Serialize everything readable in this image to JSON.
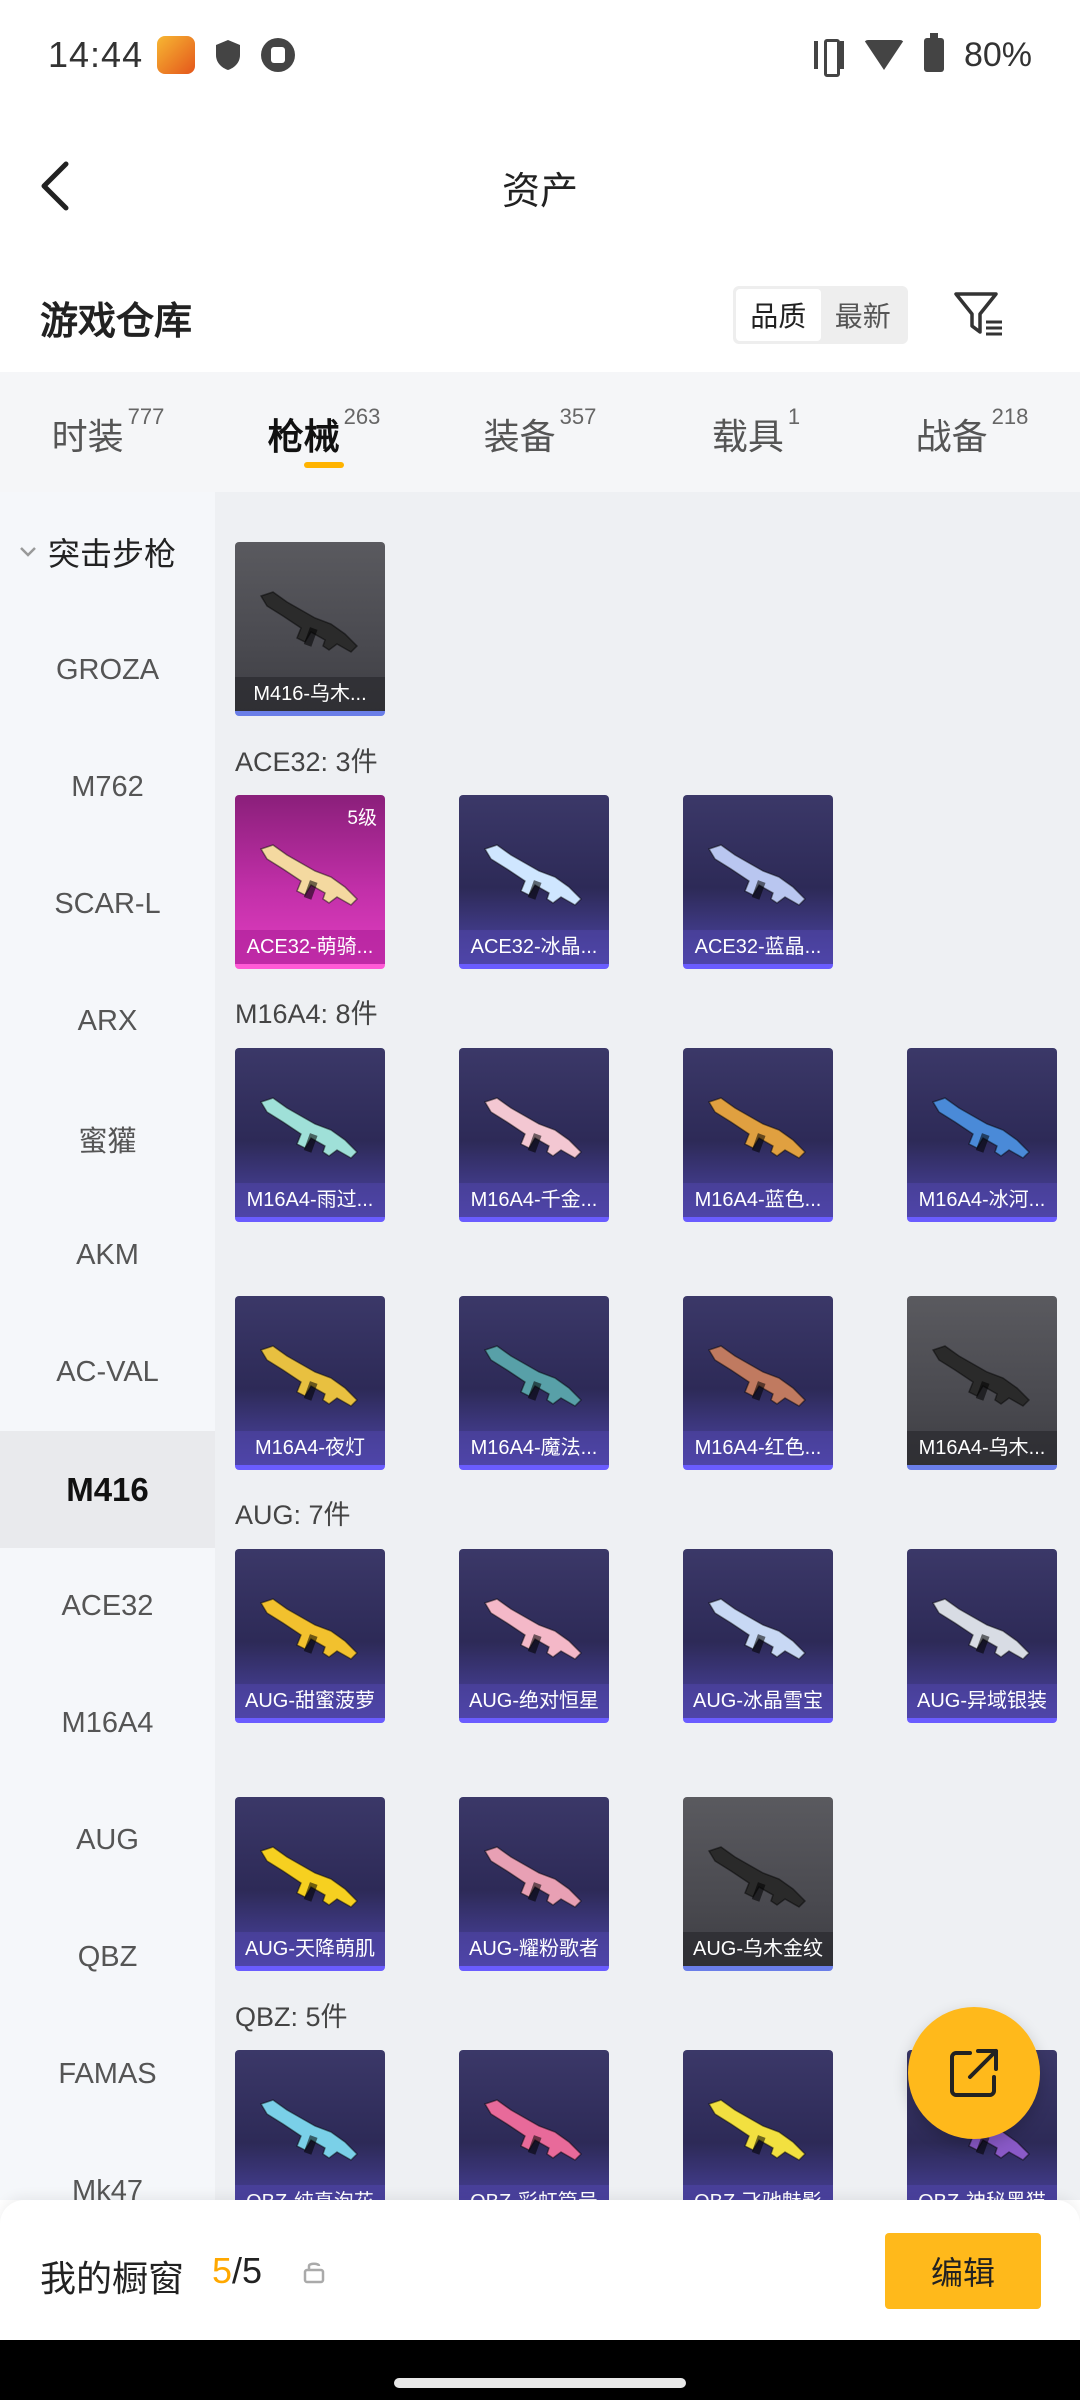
{
  "status_bar": {
    "time": "14:44",
    "battery": "80%"
  },
  "header": {
    "title": "资产"
  },
  "section": {
    "title": "游戏仓库",
    "sort_options": [
      "品质",
      "最新"
    ]
  },
  "tabs": [
    {
      "label": "时装",
      "count": "777"
    },
    {
      "label": "枪械",
      "count": "263"
    },
    {
      "label": "装备",
      "count": "357"
    },
    {
      "label": "载具",
      "count": "1"
    },
    {
      "label": "战备",
      "count": "218"
    }
  ],
  "sidebar": {
    "category": "突击步枪",
    "items": [
      "GROZA",
      "M762",
      "SCAR-L",
      "ARX",
      "蜜獾",
      "AKM",
      "AC-VAL",
      "M416",
      "ACE32",
      "M16A4",
      "AUG",
      "QBZ",
      "FAMAS",
      "Mk47"
    ]
  },
  "groups": {
    "m416": {
      "items": [
        {
          "name": "M416-乌木...",
          "rarity": "gray",
          "gun_color": "#2b2b2b"
        }
      ]
    },
    "ace32": {
      "label": "ACE32: 3件",
      "items": [
        {
          "name": "ACE32-萌骑...",
          "rarity": "pink",
          "badge": "5级",
          "gun_color": "#f4d9a0"
        },
        {
          "name": "ACE32-冰晶...",
          "rarity": "purple",
          "gun_color": "#cfe6ff"
        },
        {
          "name": "ACE32-蓝晶...",
          "rarity": "purple",
          "gun_color": "#b9c6f0"
        }
      ]
    },
    "m16a4": {
      "label": "M16A4: 8件",
      "items": [
        {
          "name": "M16A4-雨过...",
          "rarity": "purple",
          "gun_color": "#9fe0d8"
        },
        {
          "name": "M16A4-千金...",
          "rarity": "purple",
          "gun_color": "#f3c7d2"
        },
        {
          "name": "M16A4-蓝色...",
          "rarity": "purple",
          "gun_color": "#e0a040"
        },
        {
          "name": "M16A4-冰河...",
          "rarity": "purple",
          "gun_color": "#4a8ad8"
        },
        {
          "name": "M16A4-夜灯",
          "rarity": "purple",
          "gun_color": "#e8c040"
        },
        {
          "name": "M16A4-魔法...",
          "rarity": "purple",
          "gun_color": "#58a0a8"
        },
        {
          "name": "M16A4-红色...",
          "rarity": "purple",
          "gun_color": "#c07a60"
        },
        {
          "name": "M16A4-乌木...",
          "rarity": "gray",
          "gun_color": "#2a2a2a"
        }
      ]
    },
    "aug": {
      "label": "AUG: 7件",
      "items": [
        {
          "name": "AUG-甜蜜菠萝",
          "rarity": "purple",
          "gun_color": "#f2c12e"
        },
        {
          "name": "AUG-绝对恒星",
          "rarity": "purple",
          "gun_color": "#f4b8c8"
        },
        {
          "name": "AUG-冰晶雪宝",
          "rarity": "purple",
          "gun_color": "#c8d8f4"
        },
        {
          "name": "AUG-异域银装",
          "rarity": "purple",
          "gun_color": "#d8dce4"
        },
        {
          "name": "AUG-天降萌肌",
          "rarity": "purple",
          "gun_color": "#f6d020"
        },
        {
          "name": "AUG-耀粉歌者",
          "rarity": "purple",
          "gun_color": "#e8a0b4"
        },
        {
          "name": "AUG-乌木金纹",
          "rarity": "gray",
          "gun_color": "#2a2a2a"
        }
      ]
    },
    "qbz": {
      "label": "QBZ: 5件",
      "items": [
        {
          "name": "QBZ-纯真泡花",
          "rarity": "purple",
          "gun_color": "#7ad0e8"
        },
        {
          "name": "QBZ-彩虹篇号",
          "rarity": "purple",
          "gun_color": "#e86a9a"
        },
        {
          "name": "QBZ-飞驰魅影",
          "rarity": "purple",
          "gun_color": "#f2e040"
        },
        {
          "name": "QBZ-神秘黑猫",
          "rarity": "purple",
          "gun_color": "#8a5ac8"
        }
      ]
    }
  },
  "bottom_bar": {
    "label": "我的橱窗",
    "current": "5",
    "total": "/5",
    "edit_label": "编辑"
  },
  "colors": {
    "accent": "#ffb91b",
    "rare_purple": "#6a5cff",
    "rare_pink": "#e03ec0"
  },
  "icons": [
    "back-arrow-icon",
    "filter-icon",
    "share-icon",
    "lock-icon",
    "chevron-down-icon"
  ]
}
